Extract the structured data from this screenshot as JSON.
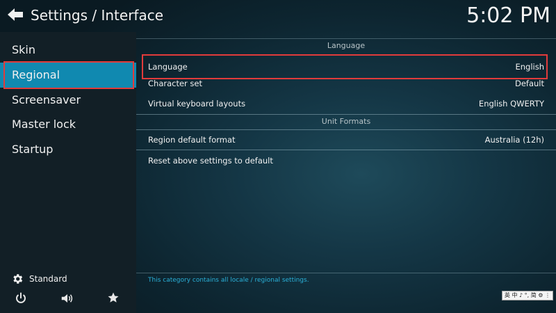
{
  "header": {
    "title": "Settings / Interface",
    "clock": "5:02 PM"
  },
  "sidebar": {
    "items": [
      {
        "label": "Skin",
        "active": false
      },
      {
        "label": "Regional",
        "active": true
      },
      {
        "label": "Screensaver",
        "active": false
      },
      {
        "label": "Master lock",
        "active": false
      },
      {
        "label": "Startup",
        "active": false
      }
    ],
    "settings_level": "Standard"
  },
  "sections": {
    "language_header": "Language",
    "unit_formats_header": "Unit Formats"
  },
  "settings": {
    "language": {
      "name": "Language",
      "value": "English"
    },
    "character_set": {
      "name": "Character set",
      "value": "Default"
    },
    "keyboard_layouts": {
      "name": "Virtual keyboard layouts",
      "value": "English QWERTY"
    },
    "region_format": {
      "name": "Region default format",
      "value": "Australia (12h)"
    },
    "reset": {
      "name": "Reset above settings to default"
    }
  },
  "footer": {
    "description": "This category contains all locale / regional settings."
  },
  "ime_toolbar": {
    "text": "英 中 ♪ °, 简 ⚙ ⋮"
  },
  "colors": {
    "accent": "#1089b0",
    "highlight_border": "#e23b3b",
    "description_text": "#2ab0d8"
  },
  "icons": {
    "back": "back-arrow-icon",
    "settings_level": "gear-icon",
    "power": "power-icon",
    "volume": "volume-icon",
    "favourites": "star-icon"
  }
}
